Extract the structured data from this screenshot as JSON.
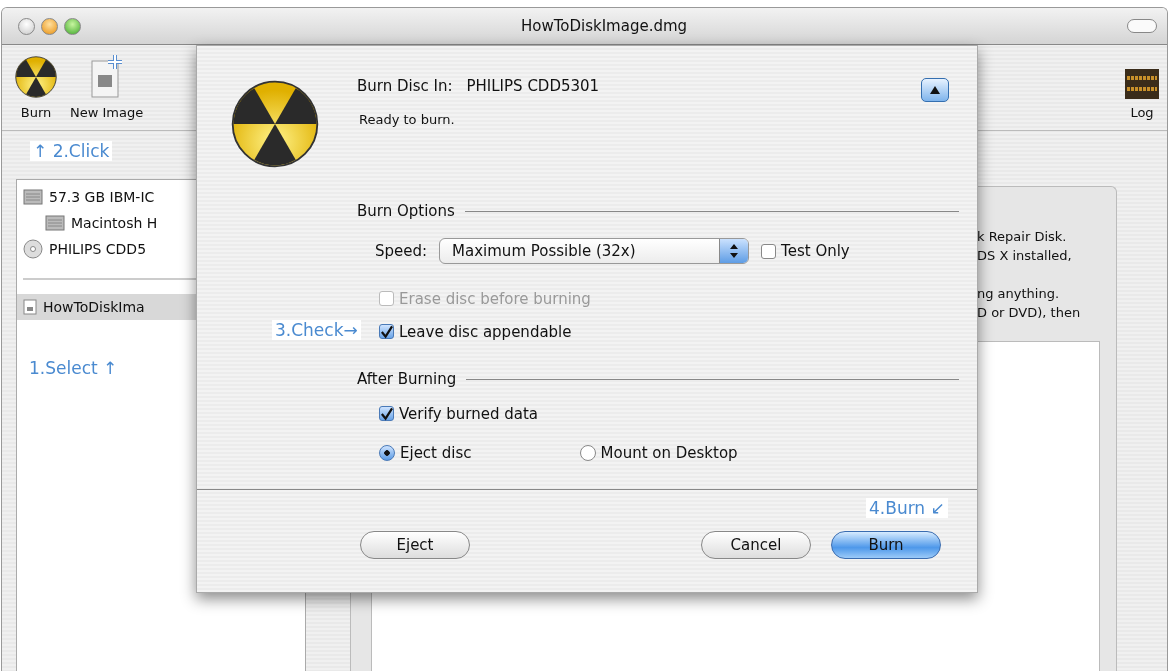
{
  "window": {
    "title": "HowToDiskImage.dmg"
  },
  "toolbar": {
    "items": [
      {
        "label": "Burn",
        "kind": "burn"
      },
      {
        "label": "New Image",
        "kind": "new-image"
      }
    ],
    "log": {
      "label": "Log"
    }
  },
  "sidebar": {
    "devices": [
      {
        "label": "57.3 GB IBM-IC",
        "kind": "disk",
        "children": [
          {
            "label": "Macintosh H",
            "kind": "disk"
          }
        ]
      },
      {
        "label": "PHILIPS CDD5",
        "kind": "cd"
      }
    ],
    "images": [
      {
        "label": "HowToDiskIma",
        "selected": true
      }
    ]
  },
  "info": {
    "paragraphs": [
      [
        "k Repair Disk.",
        "DS X installed,"
      ],
      [
        "ng anything.",
        "D or DVD), then"
      ]
    ]
  },
  "sheet": {
    "label": "Burn Disc In:",
    "device": "PHILIPS CDD5301",
    "status": "Ready to burn.",
    "expanded": true,
    "burn_options": {
      "title": "Burn Options",
      "speed_label": "Speed:",
      "speed_value": "Maximum Possible (32x)",
      "test_only": {
        "label": "Test Only",
        "checked": false,
        "disabled": false
      },
      "checkboxes": [
        {
          "label": "Erase disc before burning",
          "checked": false,
          "disabled": true
        },
        {
          "label": "Leave disc appendable",
          "checked": true,
          "disabled": false
        }
      ]
    },
    "after_burning": {
      "title": "After Burning",
      "verify": {
        "label": "Verify burned data",
        "checked": true
      },
      "radios": [
        {
          "label": "Eject disc",
          "selected": true
        },
        {
          "label": "Mount on Desktop",
          "selected": false
        }
      ]
    },
    "buttons": [
      {
        "label": "Eject",
        "default": false
      },
      {
        "label": "Cancel",
        "default": false
      },
      {
        "label": "Burn",
        "default": true
      }
    ]
  },
  "annotations": [
    {
      "text": "↑ 2.Click"
    },
    {
      "text": "1.Select ↑"
    },
    {
      "text": "3.Check→"
    },
    {
      "text": "4.Burn ↙"
    }
  ]
}
